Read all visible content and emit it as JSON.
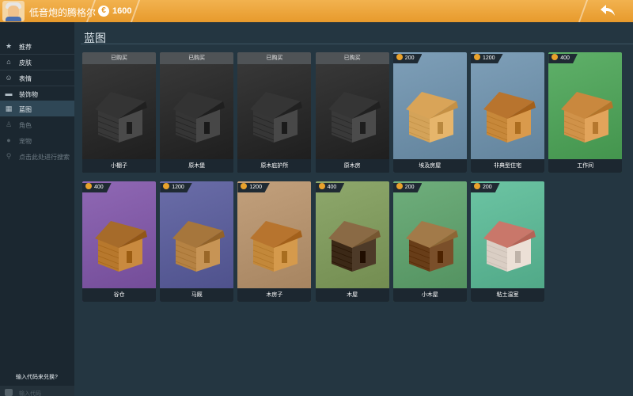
{
  "topbar": {
    "username": "低音炮的腾格尔",
    "coin_symbol": "€",
    "coins": "1600",
    "back_icon": "back-arrow-icon"
  },
  "sidebar": {
    "items": [
      {
        "label": "推荐",
        "icon": "star-icon"
      },
      {
        "label": "皮肤",
        "icon": "hanger-icon"
      },
      {
        "label": "表情",
        "icon": "emote-icon"
      },
      {
        "label": "装饰物",
        "icon": "sofa-icon"
      },
      {
        "label": "蓝图",
        "icon": "blueprint-icon"
      },
      {
        "label": "角色",
        "icon": "character-icon"
      },
      {
        "label": "宠物",
        "icon": "pet-icon"
      },
      {
        "label": "点击此处进行搜索",
        "icon": "search-icon"
      }
    ],
    "redeem_label": "输入代码来兑换?",
    "code_placeholder": "输入代码"
  },
  "main": {
    "title": "蓝图",
    "owned_label": "已购买",
    "cards": [
      {
        "name": "小棚子",
        "owned": true,
        "price": "",
        "bg": "#3a3a3a",
        "roof": "#343434",
        "wall": "#4a4a4a"
      },
      {
        "name": "原木堡",
        "owned": true,
        "price": "",
        "bg": "#3a3a3a",
        "roof": "#333333",
        "wall": "#474747"
      },
      {
        "name": "原木庇护所",
        "owned": true,
        "price": "",
        "bg": "#3a3a3a",
        "roof": "#353535",
        "wall": "#484848"
      },
      {
        "name": "原木房",
        "owned": true,
        "price": "",
        "bg": "#3a3a3a",
        "roof": "#353535",
        "wall": "#4b4b4b"
      },
      {
        "name": "埃及房屋",
        "owned": false,
        "price": "200",
        "bg": "#7e9fb8",
        "roof": "#d9a458",
        "wall": "#e6b56b"
      },
      {
        "name": "非典型住宅",
        "owned": false,
        "price": "1200",
        "bg": "#7e9fb8",
        "roof": "#b8742e",
        "wall": "#d99a4c"
      },
      {
        "name": "工作间",
        "owned": false,
        "price": "400",
        "bg": "#5fb069",
        "roof": "#c9883e",
        "wall": "#e2a45b"
      },
      {
        "name": "谷仓",
        "owned": false,
        "price": "400",
        "bg": "#8f68b4",
        "roof": "#a66b2a",
        "wall": "#c98a3f"
      },
      {
        "name": "马厩",
        "owned": false,
        "price": "1200",
        "bg": "#6a6da8",
        "roof": "#a6763c",
        "wall": "#c79455"
      },
      {
        "name": "木房子",
        "owned": false,
        "price": "1200",
        "bg": "#c2a07c",
        "roof": "#b7742e",
        "wall": "#d59a4c"
      },
      {
        "name": "木屋",
        "owned": false,
        "price": "400",
        "bg": "#8ea86c",
        "roof": "#8a6a45",
        "wall": "#4d3a28"
      },
      {
        "name": "小木屋",
        "owned": false,
        "price": "200",
        "bg": "#6fae7c",
        "roof": "#a27a49",
        "wall": "#7a4f2a"
      },
      {
        "name": "粘土温室",
        "owned": false,
        "price": "200",
        "bg": "#6cc4a3",
        "roof": "#c9776a",
        "wall": "#ece0d6"
      }
    ]
  }
}
